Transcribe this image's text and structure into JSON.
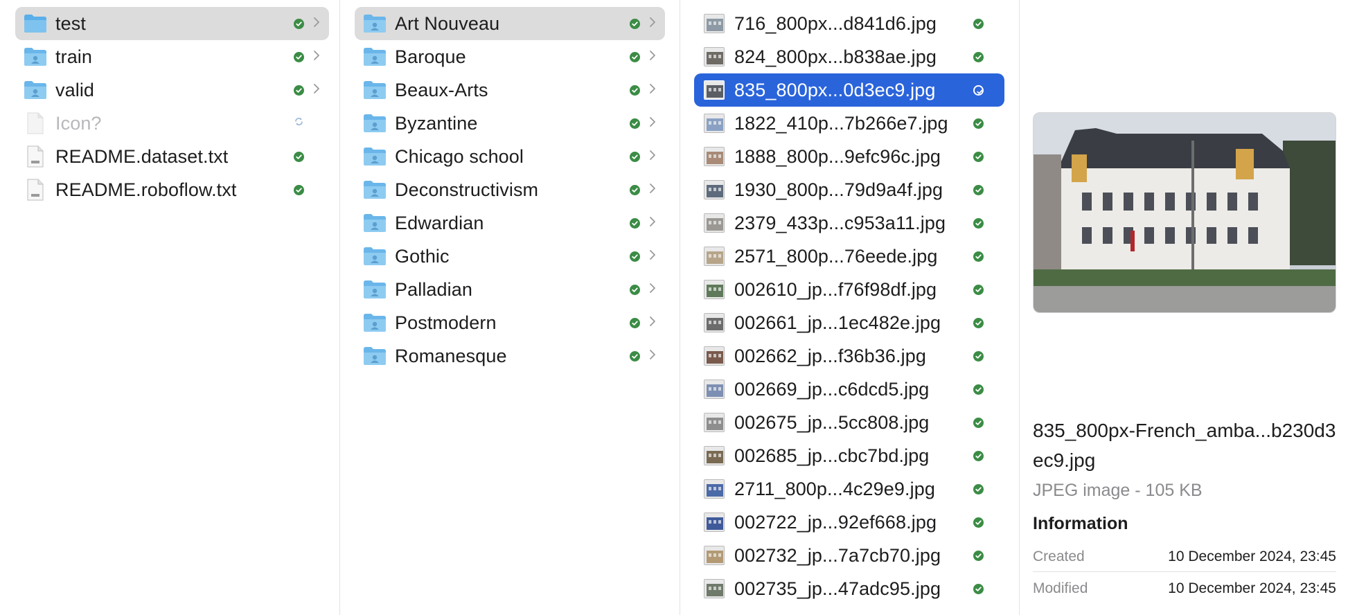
{
  "columns": {
    "col1": [
      {
        "label": "test",
        "icon": "folder-icon",
        "status": "synced",
        "chevron": true,
        "state": "selected-grey"
      },
      {
        "label": "train",
        "icon": "shared-folder-icon",
        "status": "synced",
        "chevron": true
      },
      {
        "label": "valid",
        "icon": "shared-folder-icon",
        "status": "synced",
        "chevron": true
      },
      {
        "label": "Icon?",
        "icon": "blank-file-icon",
        "status": "syncing",
        "chevron": false,
        "dim": true
      },
      {
        "label": "README.dataset.txt",
        "icon": "text-file-icon",
        "status": "synced",
        "chevron": false
      },
      {
        "label": "README.roboflow.txt",
        "icon": "text-file-icon",
        "status": "synced",
        "chevron": false
      }
    ],
    "col2": [
      {
        "label": "Art Nouveau",
        "icon": "shared-folder-icon",
        "status": "synced",
        "chevron": true,
        "state": "selected-grey"
      },
      {
        "label": "Baroque",
        "icon": "shared-folder-icon",
        "status": "synced",
        "chevron": true
      },
      {
        "label": "Beaux-Arts",
        "icon": "shared-folder-icon",
        "status": "synced",
        "chevron": true
      },
      {
        "label": "Byzantine",
        "icon": "shared-folder-icon",
        "status": "synced",
        "chevron": true
      },
      {
        "label": "Chicago school",
        "icon": "shared-folder-icon",
        "status": "synced",
        "chevron": true
      },
      {
        "label": "Deconstructivism",
        "icon": "shared-folder-icon",
        "status": "synced",
        "chevron": true
      },
      {
        "label": "Edwardian",
        "icon": "shared-folder-icon",
        "status": "synced",
        "chevron": true
      },
      {
        "label": "Gothic",
        "icon": "shared-folder-icon",
        "status": "synced",
        "chevron": true
      },
      {
        "label": "Palladian",
        "icon": "shared-folder-icon",
        "status": "synced",
        "chevron": true
      },
      {
        "label": "Postmodern",
        "icon": "shared-folder-icon",
        "status": "synced",
        "chevron": true
      },
      {
        "label": "Romanesque",
        "icon": "shared-folder-icon",
        "status": "synced",
        "chevron": true
      }
    ],
    "col3": [
      {
        "label": "716_800px...d841d6.jpg",
        "icon": "image-thumbnail-icon",
        "status": "synced",
        "tone": "#8d9aa6"
      },
      {
        "label": "824_800px...b838ae.jpg",
        "icon": "image-thumbnail-icon",
        "status": "synced",
        "tone": "#6e6a64"
      },
      {
        "label": "835_800px...0d3ec9.jpg",
        "icon": "image-thumbnail-icon",
        "status": "synced",
        "tone": "#5b5e63",
        "state": "selected-blue"
      },
      {
        "label": "1822_410p...7b266e7.jpg",
        "icon": "image-thumbnail-icon",
        "status": "synced",
        "tone": "#8aa1c4"
      },
      {
        "label": "1888_800p...9efc96c.jpg",
        "icon": "image-thumbnail-icon",
        "status": "synced",
        "tone": "#a88a76"
      },
      {
        "label": "1930_800p...79d9a4f.jpg",
        "icon": "image-thumbnail-icon",
        "status": "synced",
        "tone": "#5d6b7c"
      },
      {
        "label": "2379_433p...c953a11.jpg",
        "icon": "image-thumbnail-icon",
        "status": "synced",
        "tone": "#9b9893"
      },
      {
        "label": "2571_800p...76eede.jpg",
        "icon": "image-thumbnail-icon",
        "status": "synced",
        "tone": "#b7a58a"
      },
      {
        "label": "002610_jp...f76f98df.jpg",
        "icon": "image-thumbnail-icon",
        "status": "synced",
        "tone": "#5f7a5a"
      },
      {
        "label": "002661_jp...1ec482e.jpg",
        "icon": "image-thumbnail-icon",
        "status": "synced",
        "tone": "#6c6c6c"
      },
      {
        "label": "002662_jp...f36b36.jpg",
        "icon": "image-thumbnail-icon",
        "status": "synced",
        "tone": "#7a5a4c"
      },
      {
        "label": "002669_jp...c6dcd5.jpg",
        "icon": "image-thumbnail-icon",
        "status": "synced",
        "tone": "#7d8fb3"
      },
      {
        "label": "002675_jp...5cc808.jpg",
        "icon": "image-thumbnail-icon",
        "status": "synced",
        "tone": "#8e8e8e"
      },
      {
        "label": "002685_jp...cbc7bd.jpg",
        "icon": "image-thumbnail-icon",
        "status": "synced",
        "tone": "#7a6a52"
      },
      {
        "label": "2711_800p...4c29e9.jpg",
        "icon": "image-thumbnail-icon",
        "status": "synced",
        "tone": "#4b6aa8"
      },
      {
        "label": "002722_jp...92ef668.jpg",
        "icon": "image-thumbnail-icon",
        "status": "synced",
        "tone": "#3f5a9a"
      },
      {
        "label": "002732_jp...7a7cb70.jpg",
        "icon": "image-thumbnail-icon",
        "status": "synced",
        "tone": "#b39a74"
      },
      {
        "label": "002735_jp...47adc95.jpg",
        "icon": "image-thumbnail-icon",
        "status": "synced",
        "tone": "#6f7a6a"
      }
    ]
  },
  "preview": {
    "file_name": "835_800px-French_amba...b230d3ec9.jpg",
    "kind_size": "JPEG image - 105 KB",
    "info_heading": "Information",
    "created_label": "Created",
    "created_value": "10 December 2024, 23:45",
    "modified_label": "Modified",
    "modified_value": "10 December 2024, 23:45"
  },
  "colors": {
    "selection_blue": "#2a64db",
    "selection_grey": "#dcdcdc",
    "folder_blue": "#7ec3ef",
    "sync_green": "#3b8c45"
  }
}
